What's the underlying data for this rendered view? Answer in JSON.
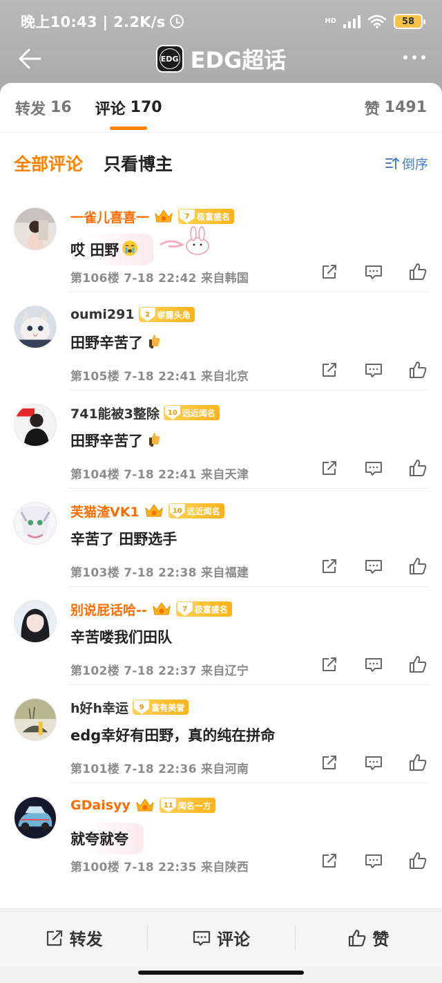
{
  "status_bar": {
    "time": "晚上10:43 | 2.2K/s",
    "hd": "HD",
    "battery": "58"
  },
  "header": {
    "title": "EDG超话",
    "logo_text": "EDG"
  },
  "tabs": [
    {
      "label": "转发",
      "count": "16"
    },
    {
      "label": "评论",
      "count": "170"
    },
    {
      "label": "赞",
      "count": "1491"
    }
  ],
  "filters": {
    "all": "全部评论",
    "owner_only": "只看博主",
    "sort": "倒序"
  },
  "comments": [
    {
      "name": "一雀儿喜喜一",
      "vip": true,
      "crown": true,
      "fan_level": "7",
      "fan_title": "极富盛名",
      "content": "哎 田野",
      "emoji": "crying-face-icon",
      "floor": "第106楼",
      "time": "7-18 22:42",
      "location": "来自韩国",
      "bubble": true
    },
    {
      "name": "oumi291",
      "vip": false,
      "crown": false,
      "fan_level": "2",
      "fan_title": "崭露头角",
      "content": "田野辛苦了",
      "emoji": "thumbs-up-icon",
      "floor": "第105楼",
      "time": "7-18 22:41",
      "location": "来自北京",
      "bubble": false
    },
    {
      "name": "741能被3整除",
      "vip": false,
      "crown": false,
      "fan_level": "10",
      "fan_title": "远近闻名",
      "content": "田野辛苦了",
      "emoji": "thumbs-up-icon",
      "floor": "第104楼",
      "time": "7-18 22:41",
      "location": "来自天津",
      "bubble": false
    },
    {
      "name": "芙猫渣VK1",
      "vip": true,
      "crown": true,
      "fan_level": "10",
      "fan_title": "远近闻名",
      "content": "辛苦了 田野选手",
      "emoji": "",
      "floor": "第103楼",
      "time": "7-18 22:38",
      "location": "来自福建",
      "bubble": false
    },
    {
      "name": "别说屁话哈--",
      "vip": true,
      "crown": true,
      "fan_level": "7",
      "fan_title": "极富盛名",
      "content": "辛苦喽我们田队",
      "emoji": "",
      "floor": "第102楼",
      "time": "7-18 22:37",
      "location": "来自辽宁",
      "bubble": false
    },
    {
      "name": "h好h幸运",
      "vip": false,
      "crown": false,
      "fan_level": "9",
      "fan_title": "富有美誉",
      "content": "edg幸好有田野，真的纯在拼命",
      "emoji": "",
      "floor": "第101楼",
      "time": "7-18 22:36",
      "location": "来自河南",
      "bubble": false
    },
    {
      "name": "GDaisyy",
      "vip": true,
      "crown": true,
      "fan_level": "11",
      "fan_title": "闻名一方",
      "content": "就夸就夸",
      "emoji": "",
      "floor": "第100楼",
      "time": "7-18 22:35",
      "location": "来自陕西",
      "bubble": true
    }
  ],
  "bottom_bar": {
    "repost": "转发",
    "comment": "评论",
    "like": "赞"
  },
  "colors": {
    "accent": "#ff8200",
    "vip_name": "#ff6d00",
    "link_blue": "#4a7fc4",
    "badge": "#ffb31a"
  }
}
